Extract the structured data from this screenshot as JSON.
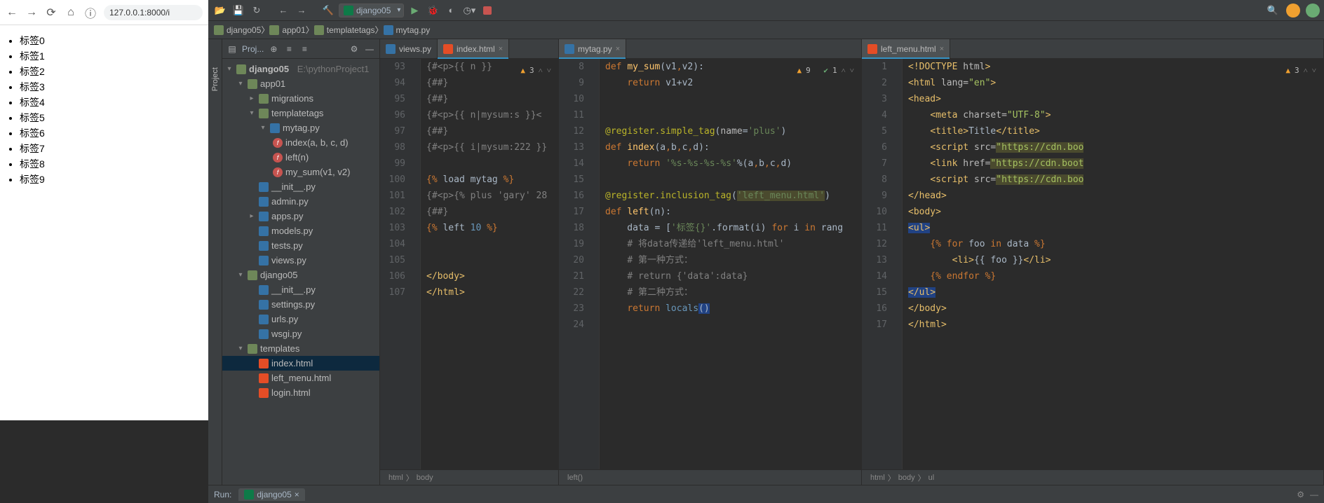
{
  "chrome": {
    "url": "127.0.0.1:8000/i",
    "items": [
      "标签0",
      "标签1",
      "标签2",
      "标签3",
      "标签4",
      "标签5",
      "标签6",
      "标签7",
      "标签8",
      "标签9"
    ]
  },
  "runConfig": "django05",
  "breadcrumbs": [
    "django05",
    "app01",
    "templatetags",
    "mytag.py"
  ],
  "projHdr": "Proj...",
  "sidebarLabel": "Project",
  "tree": {
    "root": "django05",
    "rootHint": "E:\\pythonProject1",
    "app01": "app01",
    "migrations": "migrations",
    "ttags": "templatetags",
    "mytag": "mytag.py",
    "f_index": "index(a, b, c, d)",
    "f_left": "left(n)",
    "f_mysum": "my_sum(v1, v2)",
    "initpy": "__init__.py",
    "admin": "admin.py",
    "apps": "apps.py",
    "models": "models.py",
    "tests": "tests.py",
    "views": "views.py",
    "djpkg": "django05",
    "init2": "__init__.py",
    "settings": "settings.py",
    "urls": "urls.py",
    "wsgi": "wsgi.py",
    "templates": "templates",
    "indexhtml": "index.html",
    "leftmenu": "left_menu.html",
    "login": "login.html"
  },
  "tabs": {
    "views": "views.py",
    "index": "index.html",
    "mytag": "mytag.py",
    "leftmenu": "left_menu.html"
  },
  "pane1": {
    "warn": "3",
    "lines": [
      "93",
      "94",
      "95",
      "96",
      "97",
      "98",
      "99",
      "100",
      "101",
      "102",
      "103",
      "104",
      "105",
      "106",
      "107"
    ],
    "crumb": [
      "html",
      "body"
    ]
  },
  "pane2": {
    "warn": "9",
    "check": "1",
    "lines": [
      "8",
      "9",
      "10",
      "11",
      "12",
      "13",
      "14",
      "15",
      "16",
      "17",
      "18",
      "19",
      "20",
      "21",
      "22",
      "23",
      "24"
    ],
    "crumb": [
      "left()"
    ]
  },
  "pane3": {
    "warn": "3",
    "lines": [
      "1",
      "2",
      "3",
      "4",
      "5",
      "6",
      "7",
      "8",
      "9",
      "10",
      "11",
      "12",
      "13",
      "14",
      "15",
      "16",
      "17"
    ],
    "crumb": [
      "html",
      "body",
      "ul"
    ]
  },
  "footer": {
    "run": "Run:",
    "runTab": "django05"
  }
}
